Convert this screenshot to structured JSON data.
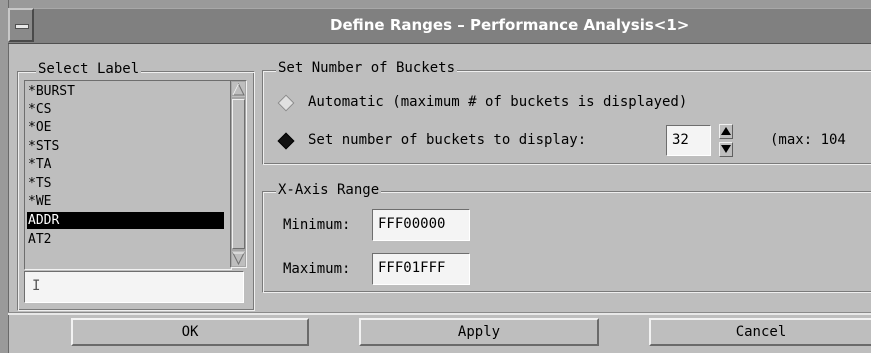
{
  "window": {
    "title": "Define Ranges – Performance Analysis<1>"
  },
  "select_label": {
    "title": "Select Label",
    "items": [
      "*BURST",
      "*CS",
      "*OE",
      "*STS",
      "*TA",
      "*TS",
      "*WE",
      "ADDR",
      "AT2"
    ],
    "selected": "ADDR",
    "input_value": ""
  },
  "buckets": {
    "title": "Set Number of Buckets",
    "automatic_label": "Automatic (maximum # of buckets is displayed)",
    "set_label": "Set number of buckets to display:",
    "value": "32",
    "max_text": "(max: 104",
    "selected_option": "set"
  },
  "x_axis": {
    "title": "X-Axis Range",
    "minimum_label": "Minimum:",
    "minimum_value": "FFF00000",
    "maximum_label": "Maximum:",
    "maximum_value": "FFF01FFF"
  },
  "buttons": {
    "ok": "OK",
    "apply": "Apply",
    "cancel": "Cancel"
  },
  "icons": {
    "window_menu": "window-menu-icon",
    "spin_up": "arrow-up-icon",
    "spin_down": "arrow-down-icon"
  }
}
